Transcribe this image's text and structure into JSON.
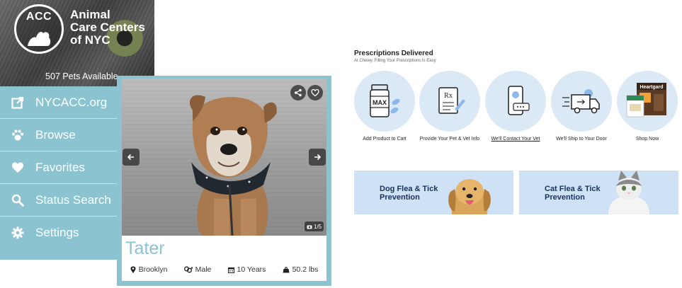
{
  "acc": {
    "logo_letters": "ACC",
    "name_lines": [
      "Animal",
      "Care Centers",
      "of NYC"
    ],
    "pets_available": "507 Pets Available",
    "menu": [
      {
        "label": "NYCACC.org",
        "icon": "external-link-icon"
      },
      {
        "label": "Browse",
        "icon": "paw-icon"
      },
      {
        "label": "Favorites",
        "icon": "heart-icon"
      },
      {
        "label": "Status Search",
        "icon": "search-icon"
      },
      {
        "label": "Settings",
        "icon": "gear-icon"
      }
    ],
    "accent_color": "#8bc3d1"
  },
  "pet": {
    "name": "Tater",
    "photo_count": "1/5",
    "location": "Brooklyn",
    "sex": "Male",
    "age": "10 Years",
    "weight": "50.2 lbs"
  },
  "chewy": {
    "title": "Prescriptions Delivered",
    "subtitle": "At Chewy, Filling Your Prescriptions Is Easy",
    "steps": [
      {
        "label": "Add Product to Cart",
        "icon": "medicine-bottle-icon",
        "bottle_text": "MAX"
      },
      {
        "label": "Provide Your Pet & Vet Info",
        "icon": "prescription-form-icon",
        "form_text": "Rx"
      },
      {
        "label": "We'll Contact Your Vet",
        "icon": "phone-icon"
      },
      {
        "label": "We'll Ship to Your Door",
        "icon": "delivery-truck-icon"
      },
      {
        "label": "Shop Now",
        "icon": "product-box-icon",
        "box_text": "Heartgard"
      }
    ],
    "banners": [
      {
        "label": "Dog Flea & Tick Prevention"
      },
      {
        "label": "Cat Flea & Tick Prevention"
      }
    ],
    "banner_text_color": "#17335f",
    "circle_color": "#dbe9f6"
  }
}
